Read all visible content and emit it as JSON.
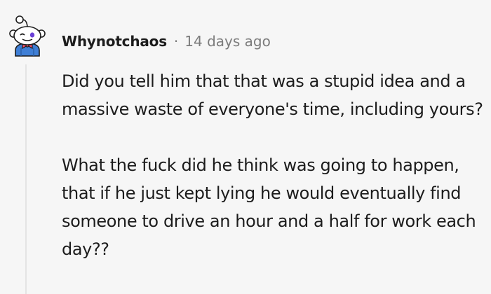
{
  "comment": {
    "username": "Whynotchaos",
    "separator": "·",
    "timestamp": "14 days ago",
    "paragraphs": [
      "Did you tell him that that was a stupid idea and a massive waste of everyone's time, including yours?",
      "What the fuck did he think was going to happen, that if he just kept lying he would eventually find someone to drive an hour and a half for work each day??"
    ]
  },
  "colors": {
    "background": "#f6f6f6",
    "text": "#1c1c1c",
    "meta": "#7c7c7c",
    "thread_line": "#e4e4e4",
    "avatar_shirt": "#3f7fd6",
    "avatar_bow": "#ff4f6b"
  },
  "icons": {
    "avatar": "reddit-snoo-avatar-icon"
  }
}
